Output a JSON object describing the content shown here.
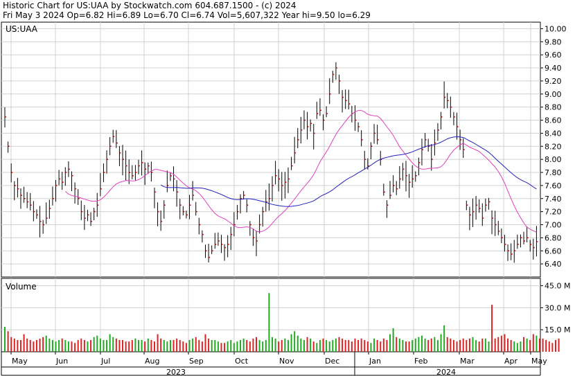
{
  "header": {
    "line1": "Historic Chart for US:UAA by Stockwatch.com 604.687.1500 - (c) 2024",
    "line2": "Fri May  3 2024  Op=6.82  Hi=6.89  Lo=6.70  Cl=6.74  Vol=5,607,322  Year hi=9.50  lo=6.29"
  },
  "colors": {
    "up_bar": "#000000",
    "close_tick": "#cc0000",
    "ma_short": "#e040c0",
    "ma_long": "#2020c0",
    "vol_up": "#22aa22",
    "vol_down": "#dd2222",
    "grid": "#d0d0d0"
  },
  "chart_data": [
    {
      "type": "line",
      "title": "US:UAA",
      "ylim": [
        6.2,
        10.1
      ],
      "y_ticks": [
        "10.00",
        "9.80",
        "9.60",
        "9.40",
        "9.20",
        "9.00",
        "8.80",
        "8.60",
        "8.40",
        "8.20",
        "8.00",
        "7.80",
        "7.60",
        "7.40",
        "7.20",
        "7.00",
        "6.80",
        "6.60",
        "6.40"
      ],
      "x_ticks": [
        "May",
        "Jun",
        "Jul",
        "Aug",
        "Sep",
        "Oct",
        "Nov",
        "Dec",
        "Jan",
        "Feb",
        "Mar",
        "Apr",
        "May"
      ],
      "year_labels": [
        "2023",
        "2024"
      ],
      "series": [
        {
          "type": "ohlc",
          "close": [
            8.65,
            8.2,
            7.8,
            7.6,
            7.55,
            7.45,
            7.4,
            7.35,
            7.3,
            7.2,
            7.15,
            7.05,
            7.0,
            7.1,
            7.25,
            7.4,
            7.6,
            7.7,
            7.65,
            7.8,
            7.85,
            7.75,
            7.55,
            7.4,
            7.2,
            7.1,
            7.15,
            7.05,
            7.2,
            7.3,
            7.55,
            7.8,
            8.0,
            8.2,
            8.35,
            8.25,
            8.1,
            8.0,
            7.9,
            7.8,
            7.75,
            7.8,
            7.9,
            7.95,
            7.85,
            7.9,
            7.8,
            7.5,
            7.2,
            7.05,
            7.3,
            7.6,
            7.75,
            7.7,
            7.5,
            7.3,
            7.2,
            7.15,
            7.3,
            7.45,
            7.2,
            7.0,
            6.85,
            6.6,
            6.5,
            6.6,
            6.7,
            6.75,
            6.7,
            6.65,
            6.7,
            6.85,
            7.0,
            7.2,
            7.4,
            7.45,
            7.3,
            7.0,
            6.8,
            6.75,
            7.0,
            7.2,
            7.35,
            7.4,
            7.6,
            7.75,
            7.7,
            7.6,
            7.65,
            7.7,
            7.9,
            8.1,
            8.3,
            8.45,
            8.6,
            8.5,
            8.55,
            8.4,
            8.7,
            8.75,
            8.6,
            8.7,
            9.0,
            9.3,
            9.4,
            9.2,
            8.95,
            8.9,
            8.85,
            8.7,
            8.6,
            8.5,
            8.3,
            8.0,
            7.9,
            8.2,
            8.4,
            8.3,
            8.0,
            7.5,
            7.3,
            7.45,
            7.6,
            7.55,
            7.7,
            7.85,
            7.75,
            7.65,
            7.7,
            7.75,
            7.95,
            8.15,
            8.3,
            8.2,
            8.0,
            8.25,
            8.45,
            8.65,
            8.95,
            8.9,
            8.8,
            8.65,
            8.5,
            8.3,
            8.15,
            7.3,
            7.15,
            7.2,
            7.3,
            7.25,
            7.1,
            7.3,
            7.35,
            7.1,
            7.0,
            6.9,
            6.8,
            6.7,
            6.6,
            6.55,
            6.6,
            6.7,
            6.8,
            6.75,
            6.8,
            6.7,
            6.65,
            6.74
          ],
          "name": ""
        },
        {
          "name": "",
          "type": "moving_average_short"
        },
        {
          "name": "",
          "type": "moving_average_long"
        }
      ]
    },
    {
      "type": "bar",
      "title": "Volume",
      "ylim": [
        0,
        50
      ],
      "y_ticks": [
        "45.0 M",
        "30.0 M",
        "15.0 M"
      ],
      "values": [
        17,
        14,
        10,
        9,
        8,
        8,
        12,
        9,
        8,
        7,
        8,
        9,
        10,
        11,
        9,
        8,
        7,
        8,
        9,
        8,
        7,
        7,
        6,
        8,
        9,
        8,
        7,
        8,
        10,
        11,
        9,
        8,
        8,
        12,
        10,
        9,
        8,
        8,
        7,
        7,
        8,
        9,
        8,
        8,
        7,
        9,
        8,
        7,
        12,
        9,
        8,
        7,
        8,
        8,
        9,
        8,
        7,
        6,
        8,
        9,
        10,
        8,
        7,
        12,
        9,
        8,
        8,
        7,
        6,
        6,
        7,
        8,
        6,
        7,
        8,
        9,
        8,
        7,
        9,
        10,
        8,
        7,
        8,
        40,
        10,
        9,
        7,
        8,
        9,
        8,
        12,
        14,
        11,
        9,
        8,
        10,
        9,
        7,
        6,
        8,
        9,
        8,
        7,
        8,
        9,
        10,
        9,
        8,
        8,
        7,
        9,
        8,
        9,
        8,
        7,
        6,
        9,
        8,
        7,
        9,
        8,
        12,
        16,
        10,
        9,
        8,
        7,
        7,
        8,
        9,
        10,
        11,
        9,
        8,
        9,
        10,
        8,
        12,
        18,
        10,
        9,
        8,
        7,
        8,
        9,
        8,
        9,
        10,
        8,
        7,
        9,
        9,
        7,
        8,
        9,
        10,
        11,
        12,
        9,
        8,
        7,
        6,
        7,
        10,
        9,
        8,
        12,
        11,
        9,
        9,
        8,
        7,
        6,
        8,
        9
      ],
      "highlight_index": 153,
      "highlight_value": 32
    }
  ]
}
